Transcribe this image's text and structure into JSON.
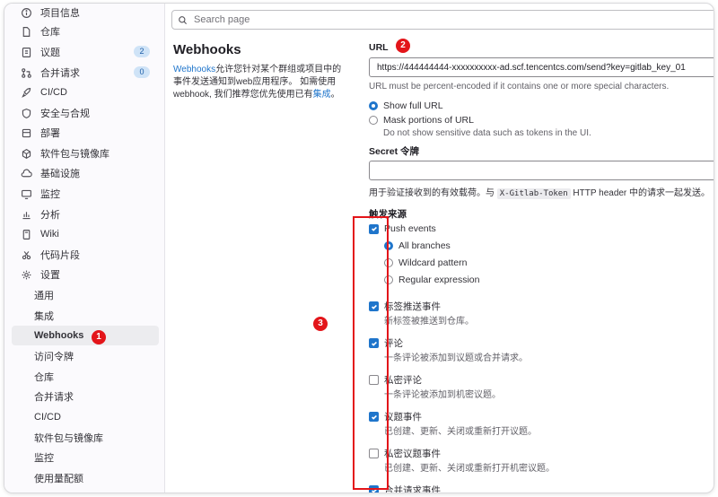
{
  "sidebar": {
    "items": [
      {
        "label": "项目信息",
        "icon": "info-icon"
      },
      {
        "label": "仓库",
        "icon": "file-icon"
      },
      {
        "label": "议题",
        "icon": "issues-icon",
        "badge": "2"
      },
      {
        "label": "合并请求",
        "icon": "merge-request-icon",
        "badge": "0"
      },
      {
        "label": "CI/CD",
        "icon": "rocket-icon"
      },
      {
        "label": "安全与合规",
        "icon": "shield-icon"
      },
      {
        "label": "部署",
        "icon": "deploy-icon"
      },
      {
        "label": "软件包与镜像库",
        "icon": "package-icon"
      },
      {
        "label": "基础设施",
        "icon": "cloud-icon"
      },
      {
        "label": "监控",
        "icon": "monitor-icon"
      },
      {
        "label": "分析",
        "icon": "chart-icon"
      },
      {
        "label": "Wiki",
        "icon": "book-icon"
      },
      {
        "label": "代码片段",
        "icon": "snippet-icon"
      },
      {
        "label": "设置",
        "icon": "gear-icon"
      }
    ],
    "settings_sub": [
      "通用",
      "集成",
      "Webhooks",
      "访问令牌",
      "仓库",
      "合并请求",
      "CI/CD",
      "软件包与镜像库",
      "监控",
      "使用量配额"
    ],
    "active_sub": "Webhooks"
  },
  "markers": {
    "one": "1",
    "two": "2",
    "three": "3"
  },
  "search": {
    "placeholder": "Search page"
  },
  "page": {
    "title": "Webhooks",
    "desc_link": "Webhooks",
    "desc_text": "允许您针对某个群组或项目中的事件发送通知到web应用程序。 如需使用webhook, 我们推荐您优先使用已有",
    "desc_link2": "集成",
    "desc_end": "。"
  },
  "url": {
    "label": "URL",
    "value": "https://444444444-xxxxxxxxxx-ad.scf.tencentcs.com/send?key=gitlab_key_01",
    "help": "URL must be percent-encoded if it contains one or more special characters.",
    "show_full": "Show full URL",
    "mask": "Mask portions of URL",
    "mask_help": "Do not show sensitive data such as tokens in the UI."
  },
  "secret": {
    "label": "Secret 令牌",
    "help_pre": "用于验证接收到的有效载荷。与",
    "help_code": "X-Gitlab-Token",
    "help_post": "HTTP header 中的请求一起发送。"
  },
  "triggers": {
    "label": "触发来源",
    "push": "Push events",
    "branches": [
      "All branches",
      "Wildcard pattern",
      "Regular expression"
    ],
    "events": [
      {
        "label": "标签推送事件",
        "help": "新标签被推送到仓库。",
        "checked": true
      },
      {
        "label": "评论",
        "help": "一条评论被添加到议题或合并请求。",
        "checked": true
      },
      {
        "label": "私密评论",
        "help": "一条评论被添加到机密议题。",
        "checked": false
      },
      {
        "label": "议题事件",
        "help": "已创建、更新、关闭或重新打开议题。",
        "checked": true
      },
      {
        "label": "私密议题事件",
        "help": "已创建、更新、关闭或重新打开机密议题。",
        "checked": false
      },
      {
        "label": "合并请求事件",
        "help": "",
        "checked": true
      }
    ]
  },
  "colors": {
    "accent": "#1f75cb",
    "marker": "#e3151a"
  }
}
